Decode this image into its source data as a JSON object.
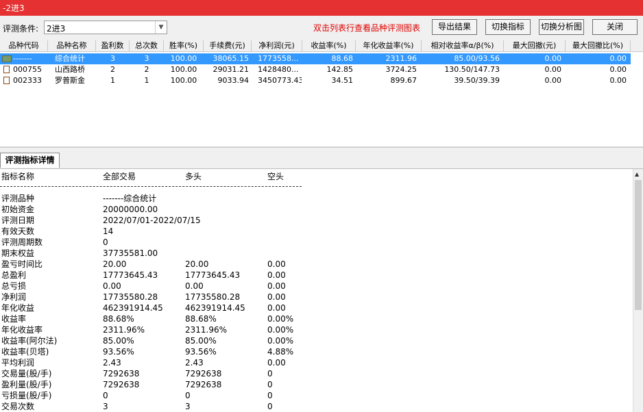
{
  "window": {
    "title": "-2进3"
  },
  "toolbar": {
    "condition_label": "评测条件:",
    "condition_value": "2进3",
    "hint": "双击列表行查看品种评测图表",
    "export_label": "导出结果",
    "switch_indicator_label": "切换指标",
    "switch_chart_label": "切换分析图",
    "close_label": "关闭"
  },
  "table": {
    "headers": [
      "品种代码",
      "品种名称",
      "盈利数",
      "总次数",
      "胜率(%)",
      "手续费(元)",
      "净利润(元)",
      "收益率(%)",
      "年化收益率(%)",
      "相对收益率α/β(%)",
      "最大回撤(元)",
      "最大回撤比(%)"
    ],
    "rows": [
      {
        "code": "-------",
        "name": "综合统计",
        "wins": "3",
        "total": "3",
        "win_rate": "100.00",
        "fee": "38065.15",
        "net_profit": "1773558...",
        "return": "88.68",
        "annual": "2311.96",
        "relative": "85.00/93.56",
        "max_dd": "0.00",
        "max_dd_ratio": "0.00"
      },
      {
        "code": "000755",
        "name": "山西路桥",
        "wins": "2",
        "total": "2",
        "win_rate": "100.00",
        "fee": "29031.21",
        "net_profit": "1428480...",
        "return": "142.85",
        "annual": "3724.25",
        "relative": "130.50/147.73",
        "max_dd": "0.00",
        "max_dd_ratio": "0.00"
      },
      {
        "code": "002333",
        "name": "罗普斯金",
        "wins": "1",
        "total": "1",
        "win_rate": "100.00",
        "fee": "9033.94",
        "net_profit": "3450773.43",
        "return": "34.51",
        "annual": "899.67",
        "relative": "39.50/39.39",
        "max_dd": "0.00",
        "max_dd_ratio": "0.00"
      }
    ]
  },
  "detail": {
    "tab_label": "评测指标详情",
    "columns": [
      "指标名称",
      "全部交易",
      "多头",
      "空头"
    ],
    "separator": "------------------------------------------------------------------------",
    "rows": [
      [
        "评测品种",
        "-------综合统计",
        "",
        ""
      ],
      [
        "初始资金",
        "20000000.00",
        "",
        ""
      ],
      [
        "评测日期",
        "2022/07/01-2022/07/15",
        "",
        ""
      ],
      [
        "有效天数",
        "14",
        "",
        ""
      ],
      [
        "评测周期数",
        "0",
        "",
        ""
      ],
      [
        "期末权益",
        "37735581.00",
        "",
        ""
      ],
      [
        "盈亏时间比",
        "20.00",
        "20.00",
        "0.00"
      ],
      [
        "总盈利",
        "17773645.43",
        "17773645.43",
        "0.00"
      ],
      [
        "总亏损",
        "0.00",
        "0.00",
        "0.00"
      ],
      [
        "净利润",
        "17735580.28",
        "17735580.28",
        "0.00"
      ],
      [
        "年化收益",
        "462391914.45",
        "462391914.45",
        "0.00"
      ],
      [
        "收益率",
        "88.68%",
        "88.68%",
        "0.00%"
      ],
      [
        "年化收益率",
        "2311.96%",
        "2311.96%",
        "0.00%"
      ],
      [
        "收益率(阿尔法)",
        "85.00%",
        "85.00%",
        "0.00%"
      ],
      [
        "收益率(贝塔)",
        "93.56%",
        "93.56%",
        "4.88%"
      ],
      [
        "平均利润",
        "2.43",
        "2.43",
        "0.00"
      ],
      [
        "交易量(股/手)",
        "7292638",
        "7292638",
        "0"
      ],
      [
        "盈利量(股/手)",
        "7292638",
        "7292638",
        "0"
      ],
      [
        "亏损量(股/手)",
        "0",
        "0",
        "0"
      ],
      [
        "交易次数",
        "3",
        "3",
        "0"
      ]
    ]
  }
}
